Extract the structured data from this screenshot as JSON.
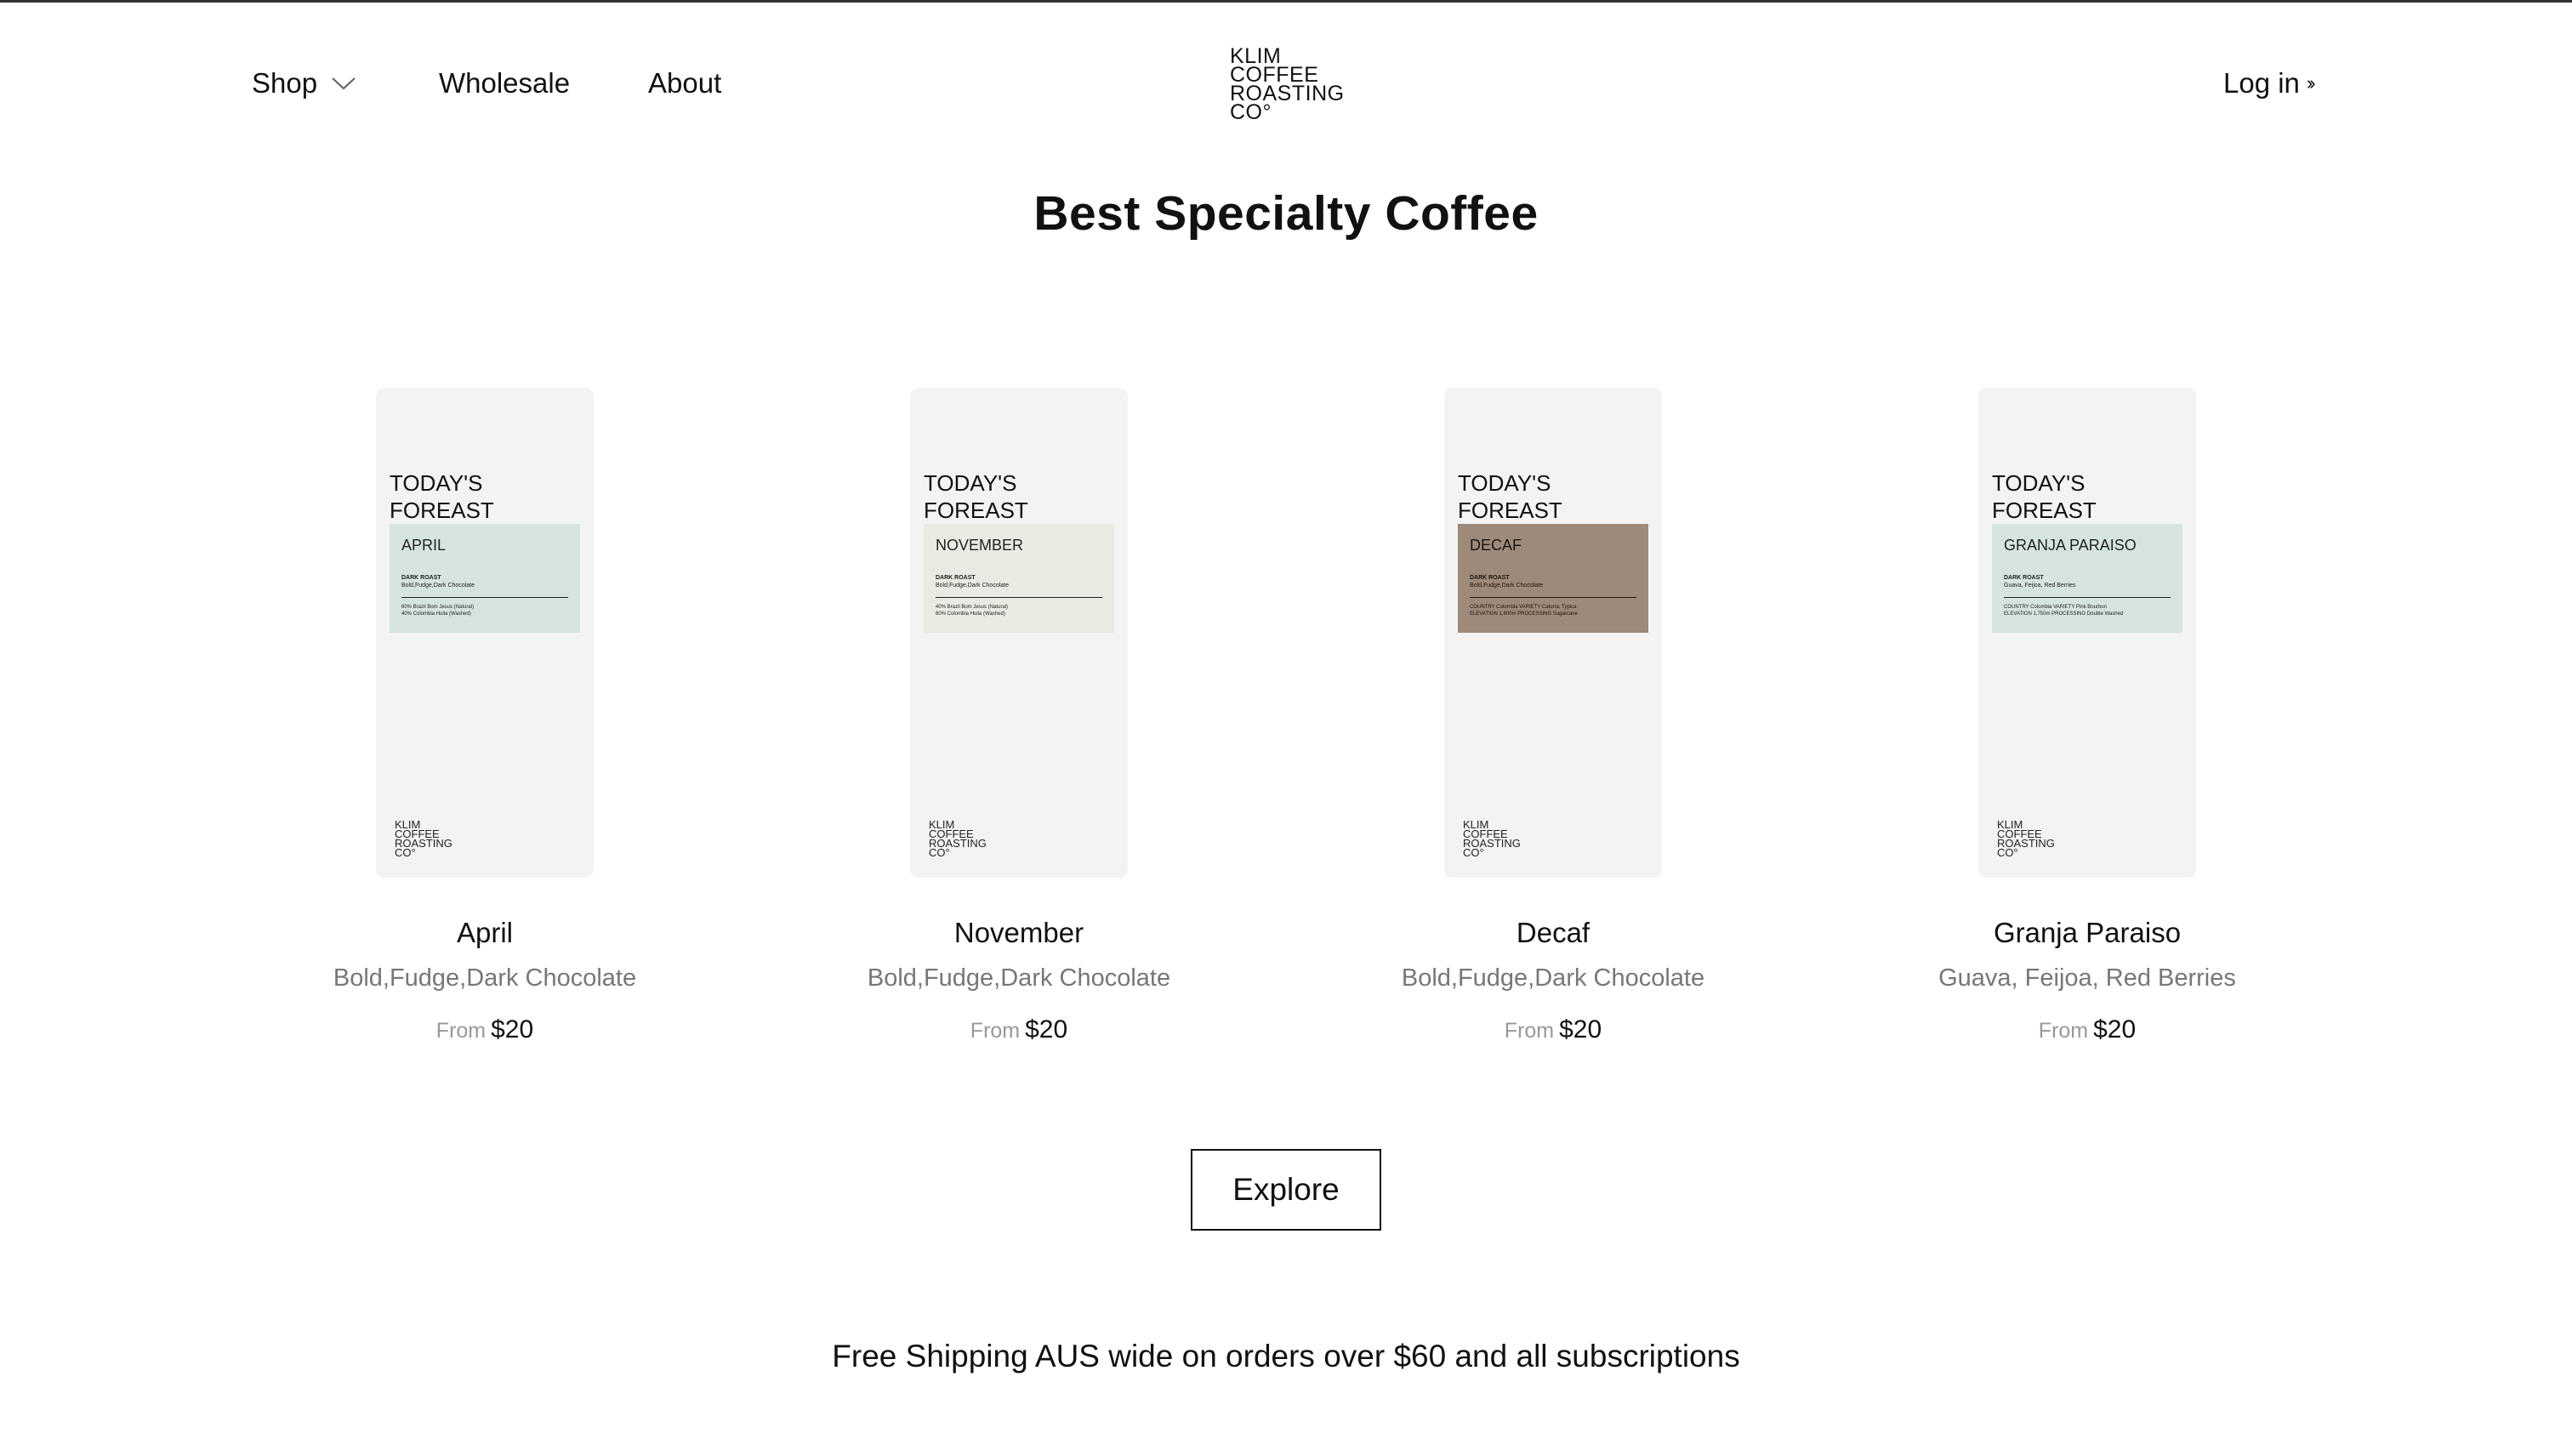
{
  "header": {
    "nav": {
      "shop": "Shop",
      "wholesale": "Wholesale",
      "about": "About"
    },
    "logo_lines": [
      "KLIM",
      "COFFEE",
      "ROASTING",
      "CO°"
    ],
    "login": "Log in",
    "login_icon": "double-chevron-right-icon"
  },
  "main": {
    "title": "Best Specialty Coffee",
    "products": [
      {
        "pack_heading_1": "TODAY'S",
        "pack_heading_2": "FOREAST",
        "label_name": "APRIL",
        "label_color": "#d5e5de",
        "label_text_color": "#222222",
        "roast": "DARK ROAST",
        "roast_notes": "Bold,Fudge,Dark Chocolate",
        "row1": "60%  Brazil Bom Jesus (Natural)",
        "row2": "40%  Colombia Huila (Washed)",
        "name": "April",
        "notes": "Bold,Fudge,Dark Chocolate",
        "price_prefix": "From",
        "price": "$20"
      },
      {
        "pack_heading_1": "TODAY'S",
        "pack_heading_2": "FOREAST",
        "label_name": "NOVEMBER",
        "label_color": "#eaeae2",
        "label_text_color": "#222222",
        "roast": "DARK ROAST",
        "roast_notes": "Bold,Fudge,Dark Chocolate",
        "row1": "40%  Brazil Bom Jesus (Natural)",
        "row2": "60%  Colombia Huila (Washed)",
        "name": "November",
        "notes": "Bold,Fudge,Dark Chocolate",
        "price_prefix": "From",
        "price": "$20"
      },
      {
        "pack_heading_1": "TODAY'S",
        "pack_heading_2": "FOREAST",
        "label_name": "DECAF",
        "label_color": "#9e8a7a",
        "label_text_color": "#1a1410",
        "roast": "DARK ROAST",
        "roast_notes": "Bold,Fudge,Dark Chocolate",
        "row1": "COUNTRY  Colombia   VARIETY  Caturra, Typica",
        "row2": "ELEVATION  1,800m   PROCESSING  Sugarcane",
        "name": "Decaf",
        "notes": "Bold,Fudge,Dark Chocolate",
        "price_prefix": "From",
        "price": "$20"
      },
      {
        "pack_heading_1": "TODAY'S",
        "pack_heading_2": "FOREAST",
        "label_name": "GRANJA PARAISO",
        "label_color": "#d5e5de",
        "label_text_color": "#222222",
        "roast": "DARK ROAST",
        "roast_notes": "Guava, Feijoa, Red Berries",
        "row1": "COUNTRY  Colombia   VARIETY  Pink Bourbon",
        "row2": "ELEVATION  1,750m   PROCESSING  Double Washed",
        "name": "Granja Paraiso",
        "notes": "Guava, Feijoa, Red Berries",
        "price_prefix": "From",
        "price": "$20"
      }
    ],
    "explore": "Explore",
    "shipping": "Free Shipping AUS wide on orders over $60 and all subscriptions"
  }
}
